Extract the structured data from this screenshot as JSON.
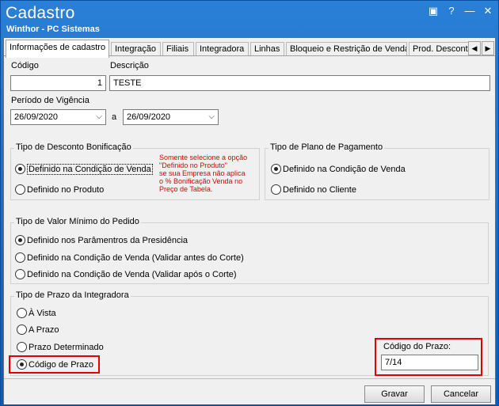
{
  "window": {
    "title": "Cadastro",
    "subtitle": "Winthor - PC Sistemas",
    "controls": {
      "restore": "▣",
      "help": "?",
      "minimize": "—",
      "close": "✕"
    }
  },
  "tabs": [
    "Informações de cadastro",
    "Integração",
    "Filiais",
    "Integradora",
    "Linhas",
    "Bloqueio e Restrição de Venda",
    "Prod. Desconto"
  ],
  "tab_scroll": {
    "left": "◀",
    "right": "▶"
  },
  "form": {
    "codigo_label": "Código",
    "codigo_value": "1",
    "descricao_label": "Descrição",
    "descricao_value": "TESTE",
    "periodo_label": "Período de Vigência",
    "data_inicio": "26/09/2020",
    "separator": "a",
    "data_fim": "26/09/2020",
    "combo_arrow": "⌵"
  },
  "desconto_group": {
    "label": "Tipo de Desconto Bonificação",
    "options": [
      "Definido na Condição de Venda",
      "Definido no Produto"
    ],
    "selected": 0,
    "note": [
      "Somente selecione a opção",
      "\"Definido no Produto\"",
      "se sua Empresa não aplica",
      "o % Bonificação Venda no",
      "Preço de Tabela."
    ]
  },
  "plano_group": {
    "label": "Tipo de Plano de Pagamento",
    "options": [
      "Definido na Condição de Venda",
      "Definido no Cliente"
    ],
    "selected": 0
  },
  "valor_minimo_group": {
    "label": "Tipo de Valor Mínimo do Pedido",
    "options": [
      "Definido nos Parâmentros da Presidência",
      "Definido na Condição  de Venda (Validar antes do Corte)",
      "Definido na Condição de Venda (Validar após o Corte)"
    ],
    "selected": 0
  },
  "prazo_group": {
    "label": "Tipo de Prazo da Integradora",
    "options": [
      "À Vista",
      "A Prazo",
      "Prazo Determinado",
      "Código de Prazo"
    ],
    "selected": 3
  },
  "codigo_prazo": {
    "label": "Código do Prazo:",
    "value": "7/14"
  },
  "buttons": {
    "save": "Gravar",
    "cancel": "Cancelar"
  },
  "colors": {
    "titlebar": "#1e6fc7",
    "highlight": "#e00000",
    "background": "#f0f0f0"
  }
}
